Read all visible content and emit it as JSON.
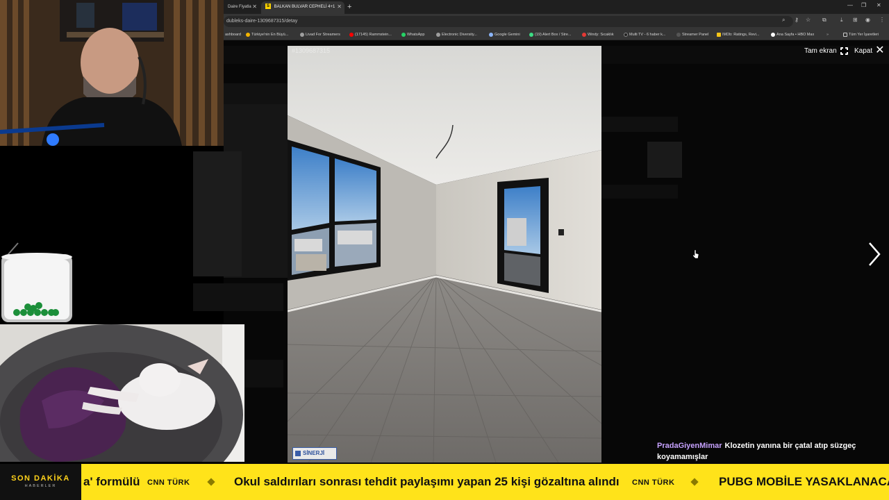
{
  "browser": {
    "tabs": [
      {
        "title": "Daire Fiyatla",
        "active": false
      },
      {
        "title": "BALKAN BULVAR CEPHELİ 4+1",
        "active": true
      }
    ],
    "url": "dubleks-daire-1309687315/detay",
    "bookmarks": [
      {
        "label": "ashboard",
        "color": "#888888"
      },
      {
        "label": "Türkiye'nin En Büyü...",
        "color": "#f4b400"
      },
      {
        "label": "Livad For Streamers",
        "color": "#9e9e9e"
      },
      {
        "label": "(17145) Rammstein...",
        "color": "#ff0000"
      },
      {
        "label": "WhatsApp",
        "color": "#25d366"
      },
      {
        "label": "Electronic Diversity...",
        "color": "#9e9e9e"
      },
      {
        "label": "Google Gemini",
        "color": "#8ab4f8"
      },
      {
        "label": "(19) Alert Box / Stre...",
        "color": "#3ddc84"
      },
      {
        "label": "Windy: Sıcaklık",
        "color": "#e53935"
      },
      {
        "label": "Multi TV - 6 haber k...",
        "color": "#222222"
      },
      {
        "label": "Streamer Panel",
        "color": "#555555"
      },
      {
        "label": "IMDb: Ratings, Revi...",
        "color": "#f5c518"
      },
      {
        "label": "Ana Sayfa • HBO Max",
        "color": "#ffffff"
      },
      {
        "label": "Tüm Yer İşaretleri",
        "color": "#cccccc"
      }
    ]
  },
  "gallery": {
    "photo_id": "#1309687315",
    "fullscreen_label": "Tam ekran",
    "close_label": "Kapat",
    "logo_text": "SİNERJİ"
  },
  "chat": {
    "user": "PradaGiyenMimar",
    "message": "Klozetin yanına bir çatal atıp süzgeç koyamamışlar"
  },
  "ticker": {
    "label_top": "SON DAKİKA",
    "label_bottom": "HABERLER",
    "items": [
      {
        "text": "a' formülü",
        "source": "CNN TÜRK"
      },
      {
        "text": "Okul saldırıları sonrası tehdit paylaşımı yapan 25 kişi gözaltına alındı",
        "source": "CNN TÜRK"
      },
      {
        "text": "PUBG MOBİLE YASAKLANACA",
        "source": ""
      }
    ]
  },
  "colors": {
    "ticker_bg": "#ffe31a",
    "ticker_label_text": "#ffd21a",
    "chat_user": "#c7a2ff"
  },
  "icons": [
    "fullscreen-icon",
    "close-icon",
    "next-arrow-icon",
    "prev-arrow-icon",
    "mouse-cursor-icon",
    "new-tab-icon",
    "extensions-icon",
    "download-icon",
    "profile-icon",
    "bookmark-star-icon"
  ]
}
